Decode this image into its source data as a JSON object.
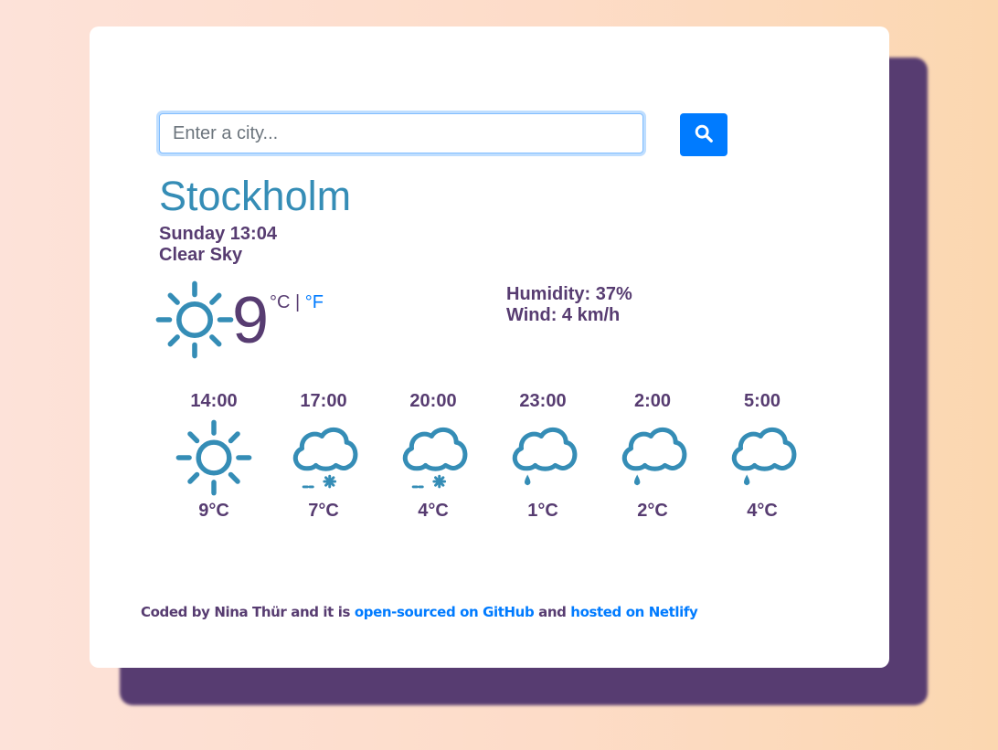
{
  "search": {
    "placeholder": "Enter a city...",
    "value": ""
  },
  "current": {
    "city": "Stockholm",
    "datetime": "Sunday 13:04",
    "description": "Clear Sky",
    "icon": "sun-icon",
    "temperature": "9",
    "unit_c": "°C",
    "unit_separator": " | ",
    "unit_f": "°F",
    "humidity": "Humidity: 37%",
    "wind": "Wind: 4 km/h"
  },
  "forecast": [
    {
      "time": "14:00",
      "temp": "9°C",
      "icon": "sun-icon"
    },
    {
      "time": "17:00",
      "temp": "7°C",
      "icon": "cloud-snow-icon"
    },
    {
      "time": "20:00",
      "temp": "4°C",
      "icon": "cloud-snow-icon"
    },
    {
      "time": "23:00",
      "temp": "1°C",
      "icon": "cloud-rain-icon"
    },
    {
      "time": "2:00",
      "temp": "2°C",
      "icon": "cloud-rain-icon"
    },
    {
      "time": "5:00",
      "temp": "4°C",
      "icon": "cloud-rain-icon"
    }
  ],
  "footer": {
    "text_1": "Coded by Nina Thür and it is ",
    "link_github": "open-sourced on GitHub",
    "text_2": " and ",
    "link_netlify": "hosted on Netlify"
  },
  "colors": {
    "accent": "#007bff",
    "primary_text": "#573c71",
    "city": "#358db6",
    "icon": "#358db6",
    "shadow": "#573c71"
  }
}
